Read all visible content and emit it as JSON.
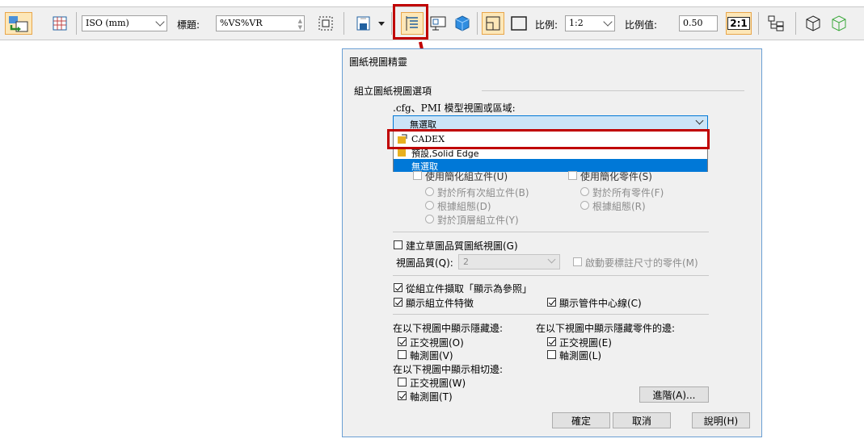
{
  "toolbar": {
    "standard_value": "ISO (mm)",
    "title_label": "標題:",
    "title_value": "%VS%VR",
    "scale_label": "比例:",
    "scale_value": "1:2",
    "scale_value_label": "比例值:",
    "scale_number": "0.50",
    "scale_button_text": "2:1"
  },
  "dialog": {
    "title": "圖紙視圖精靈",
    "section_title": "組立圖紙視圖選項",
    "cfg_label": ".cfg、PMI 模型視圖或區域:",
    "combo_value": "無選取",
    "options": [
      "CADEX",
      "預設,Solid Edge",
      "無選取"
    ],
    "use_simplified_assembly": "使用簡化組立件(U)",
    "use_simplified_part": "使用簡化零件(S)",
    "radio_all_subassemblies": "對於所有次組立件(B)",
    "radio_by_config": "根據組態(D)",
    "radio_top_level": "對於頂層組立件(Y)",
    "radio_all_parts": "對於所有零件(F)",
    "radio_by_config_part": "根據組態(R)",
    "create_draft_quality": "建立草圖品質圖紙視圖(G)",
    "view_quality_label": "視圖品質(Q):",
    "view_quality_value": "2",
    "enable_dimension_parts": "啟動要標註尺寸的零件(M)",
    "retrieve_display_as_ref": "從組立件擷取「顯示為參照」",
    "show_assembly_features": "顯示組立件特徵",
    "show_tube_centerlines": "顯示管件中心線(C)",
    "hidden_edges_label": "在以下視圖中顯示隱藏邊:",
    "hidden_edges_ortho": "正交視圖(O)",
    "hidden_edges_iso": "軸測圖(V)",
    "hidden_parts_label": "在以下視圖中顯示隱藏零件的邊:",
    "hidden_parts_ortho": "正交視圖(E)",
    "hidden_parts_iso": "軸測圖(L)",
    "tangent_edges_label": "在以下視圖中顯示相切邊:",
    "tangent_ortho": "正交視圖(W)",
    "tangent_iso": "軸測圖(T)",
    "advanced_button": "進階(A)...",
    "ok_button": "確定",
    "cancel_button": "取消",
    "help_button": "說明(H)"
  },
  "colors": {
    "annotation_red": "#c00000",
    "selection_blue": "#0078d7",
    "dialog_border": "#6a9fd4"
  }
}
